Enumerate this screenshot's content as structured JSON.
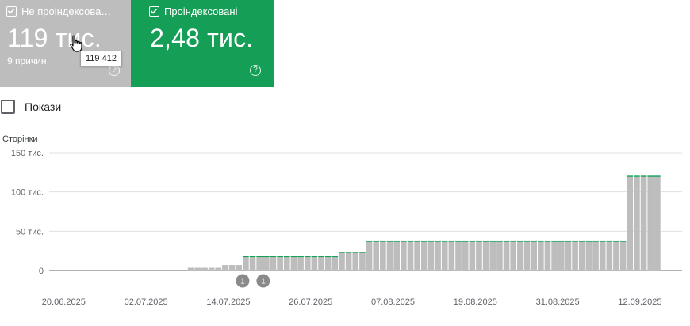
{
  "cards": {
    "not_indexed": {
      "label": "Не проіндексова…",
      "value": "119 тис.",
      "sub": "9 причин",
      "tooltip": "119 412"
    },
    "indexed": {
      "label": "Проіндексовані",
      "value": "2,48 тис."
    }
  },
  "toggle": {
    "label": "Покази"
  },
  "colors": {
    "not_indexed": "#bdbdbd",
    "indexed": "#149e56"
  },
  "chart_data": {
    "type": "bar",
    "stacked": true,
    "ylabel": "Сторінки",
    "ylim": [
      0,
      150000
    ],
    "y_ticks": [
      0,
      50000,
      100000,
      150000
    ],
    "y_tick_labels": [
      "0",
      "50 тис.",
      "100 тис.",
      "150 тис."
    ],
    "x_tick_labels": [
      "20.06.2025",
      "02.07.2025",
      "14.07.2025",
      "26.07.2025",
      "07.08.2025",
      "19.08.2025",
      "31.08.2025",
      "12.09.2025"
    ],
    "categories": [
      "20.06",
      "21.06",
      "22.06",
      "23.06",
      "24.06",
      "25.06",
      "26.06",
      "27.06",
      "28.06",
      "29.06",
      "30.06",
      "01.07",
      "02.07",
      "03.07",
      "04.07",
      "05.07",
      "06.07",
      "07.07",
      "08.07",
      "09.07",
      "10.07",
      "11.07",
      "12.07",
      "13.07",
      "14.07",
      "15.07",
      "16.07",
      "17.07",
      "18.07",
      "19.07",
      "20.07",
      "21.07",
      "22.07",
      "23.07",
      "24.07",
      "25.07",
      "26.07",
      "27.07",
      "28.07",
      "29.07",
      "30.07",
      "31.07",
      "01.08",
      "02.08",
      "03.08",
      "04.08",
      "05.08",
      "06.08",
      "07.08",
      "08.08",
      "09.08",
      "10.08",
      "11.08",
      "12.08",
      "13.08",
      "14.08",
      "15.08",
      "16.08",
      "17.08",
      "18.08",
      "19.08",
      "20.08",
      "21.08",
      "22.08",
      "23.08",
      "24.08",
      "25.08",
      "26.08",
      "27.08",
      "28.08",
      "29.08",
      "30.08",
      "31.08",
      "01.09",
      "02.09",
      "03.09",
      "04.09",
      "05.09",
      "06.09",
      "07.09",
      "08.09",
      "09.09",
      "10.09",
      "11.09",
      "12.09",
      "13.09",
      "14.09",
      "15.09"
    ],
    "series": [
      {
        "name": "Не проіндексова…",
        "color": "#bdbdbd",
        "values": [
          0,
          0,
          0,
          0,
          0,
          0,
          0,
          0,
          0,
          0,
          0,
          0,
          0,
          0,
          0,
          0,
          0,
          0,
          0,
          3500,
          3500,
          3500,
          3500,
          3500,
          7000,
          7000,
          7000,
          17000,
          17000,
          17000,
          17000,
          17000,
          17000,
          17000,
          17000,
          17000,
          17000,
          17000,
          17000,
          17000,
          17000,
          22500,
          22500,
          22500,
          22500,
          36500,
          36500,
          36500,
          36500,
          36500,
          36500,
          36500,
          36500,
          36500,
          36500,
          36500,
          36500,
          36500,
          36500,
          36500,
          36500,
          36500,
          36500,
          36500,
          36500,
          36500,
          36500,
          36500,
          36500,
          36500,
          36500,
          36500,
          36500,
          36500,
          36500,
          36500,
          36500,
          36500,
          36500,
          36500,
          36500,
          36500,
          36500,
          119000,
          119000,
          119000,
          119000,
          119000,
          119000
        ]
      },
      {
        "name": "Проіндексовані",
        "color": "#149e56",
        "values": [
          0,
          0,
          0,
          0,
          0,
          0,
          0,
          0,
          0,
          0,
          0,
          0,
          0,
          0,
          0,
          0,
          0,
          0,
          0,
          0,
          0,
          0,
          0,
          0,
          0,
          0,
          0,
          800,
          800,
          800,
          800,
          800,
          800,
          800,
          800,
          800,
          800,
          800,
          800,
          800,
          800,
          1200,
          1200,
          1200,
          1200,
          1800,
          1800,
          1800,
          1800,
          1800,
          1800,
          1800,
          1800,
          1800,
          1800,
          1800,
          1800,
          1800,
          1800,
          1800,
          1800,
          1800,
          1800,
          1800,
          1800,
          1800,
          1800,
          1800,
          1800,
          1800,
          1800,
          1800,
          1800,
          1800,
          1800,
          1800,
          1800,
          1800,
          1800,
          1800,
          1800,
          1800,
          1800,
          2480,
          2480,
          2480,
          2480,
          2480,
          2480
        ]
      }
    ],
    "annotations": [
      {
        "date": "14.07",
        "label": "1"
      },
      {
        "date": "17.07",
        "label": "1"
      }
    ]
  }
}
